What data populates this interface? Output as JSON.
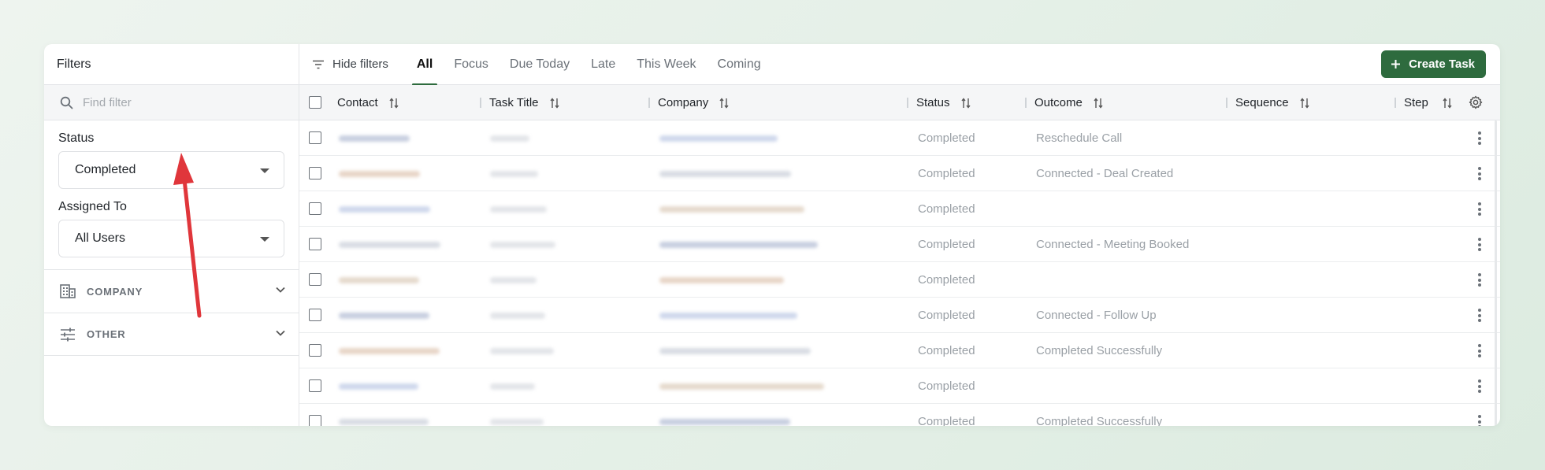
{
  "sidebar": {
    "title": "Filters",
    "search_placeholder": "Find filter",
    "status_label": "Status",
    "status_value": "Completed",
    "assigned_label": "Assigned To",
    "assigned_value": "All Users",
    "sections": [
      {
        "label": "COMPANY",
        "icon": "building-icon"
      },
      {
        "label": "OTHER",
        "icon": "sliders-icon"
      }
    ]
  },
  "toolbar": {
    "hide_filters": "Hide filters",
    "tabs": [
      "All",
      "Focus",
      "Due Today",
      "Late",
      "This Week",
      "Coming"
    ],
    "active_tab": "All",
    "create_label": "Create Task"
  },
  "table": {
    "columns": [
      "Contact",
      "Task Title",
      "Company",
      "Status",
      "Outcome",
      "Sequence",
      "Step"
    ],
    "rows": [
      {
        "status": "Completed",
        "outcome": "Reschedule Call"
      },
      {
        "status": "Completed",
        "outcome": "Connected - Deal Created"
      },
      {
        "status": "Completed",
        "outcome": ""
      },
      {
        "status": "Completed",
        "outcome": "Connected - Meeting Booked"
      },
      {
        "status": "Completed",
        "outcome": ""
      },
      {
        "status": "Completed",
        "outcome": "Connected - Follow Up"
      },
      {
        "status": "Completed",
        "outcome": "Completed Successfully"
      },
      {
        "status": "Completed",
        "outcome": ""
      },
      {
        "status": "Completed",
        "outcome": "Completed Successfully"
      }
    ]
  },
  "colors": {
    "accent": "#2e6b3e",
    "annotation": "#e0363b"
  }
}
